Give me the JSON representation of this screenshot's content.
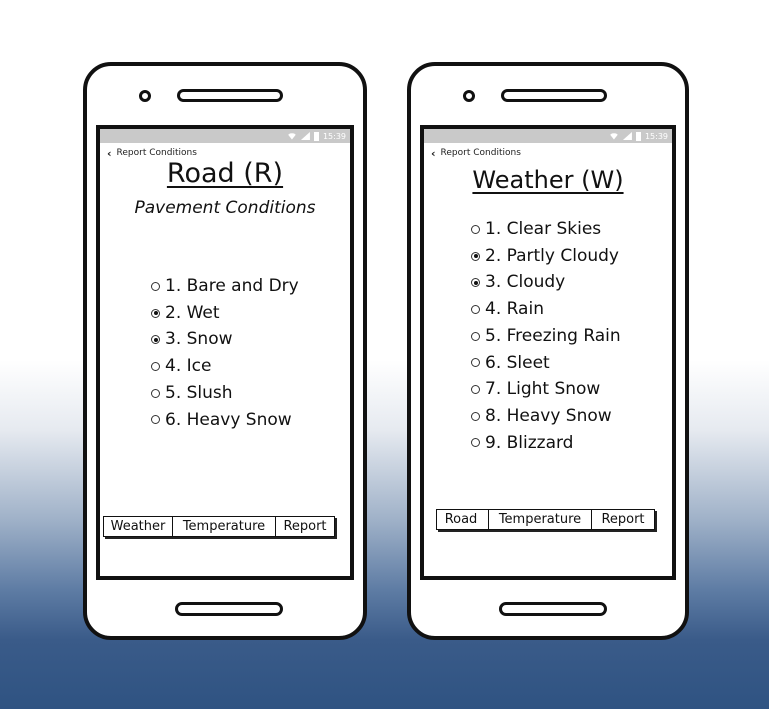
{
  "status_bar": {
    "time": "15:39"
  },
  "left_phone": {
    "back_label": "Report Conditions",
    "title": "Road (R)",
    "subtitle": "Pavement Conditions",
    "options": [
      {
        "label": "1. Bare and Dry",
        "selected": false
      },
      {
        "label": "2. Wet",
        "selected": true
      },
      {
        "label": "3. Snow",
        "selected": true
      },
      {
        "label": "4. Ice",
        "selected": false
      },
      {
        "label": "5. Slush",
        "selected": false
      },
      {
        "label": "6. Heavy Snow",
        "selected": false
      }
    ],
    "tabs": [
      "Weather",
      "Temperature",
      "Report"
    ]
  },
  "right_phone": {
    "back_label": "Report Conditions",
    "title": "Weather (W)",
    "options": [
      {
        "label": "1. Clear Skies",
        "selected": false
      },
      {
        "label": "2. Partly Cloudy",
        "selected": true
      },
      {
        "label": "3. Cloudy",
        "selected": true
      },
      {
        "label": "4. Rain",
        "selected": false
      },
      {
        "label": "5. Freezing Rain",
        "selected": false
      },
      {
        "label": "6. Sleet",
        "selected": false
      },
      {
        "label": "7. Light Snow",
        "selected": false
      },
      {
        "label": "8. Heavy Snow",
        "selected": false
      },
      {
        "label": "9. Blizzard",
        "selected": false
      }
    ],
    "tabs": [
      "Road",
      "Temperature",
      "Report"
    ]
  }
}
